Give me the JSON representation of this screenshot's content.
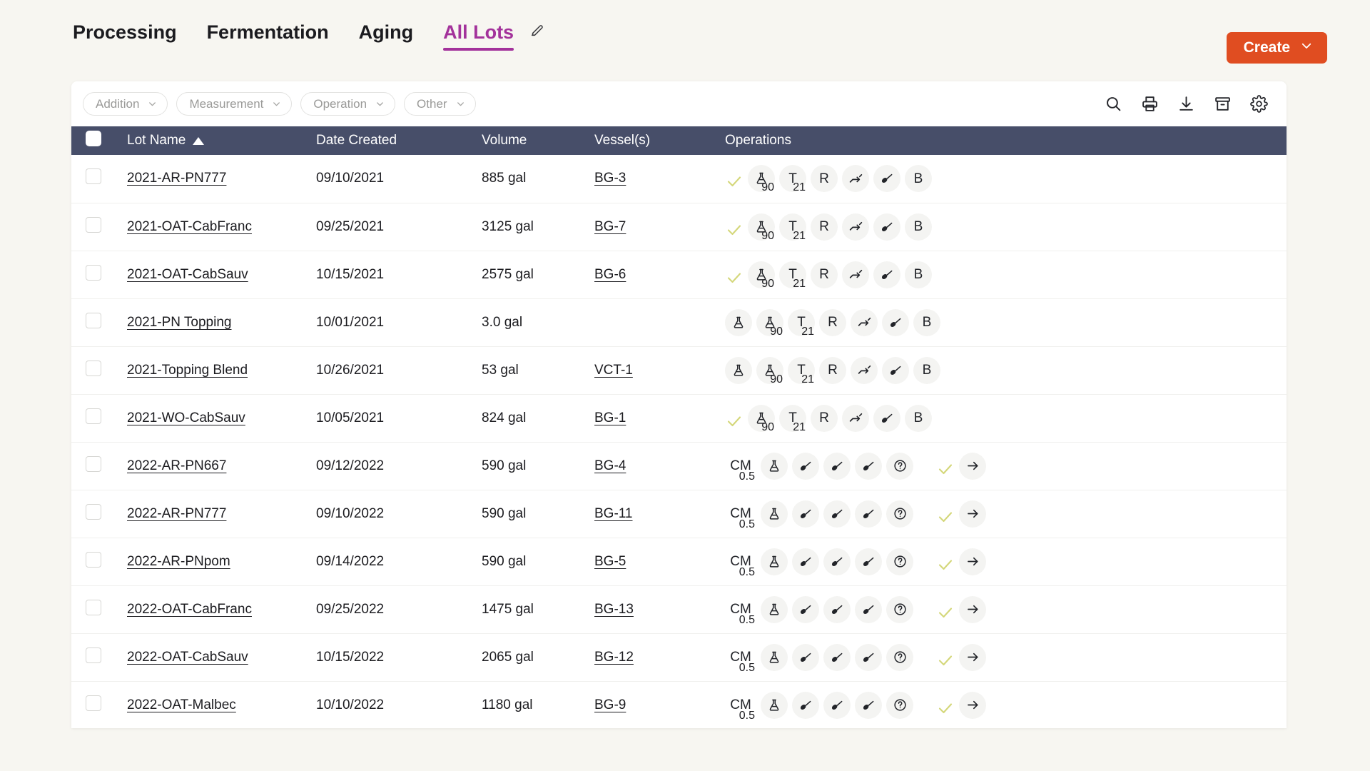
{
  "header": {
    "tabs": [
      {
        "label": "Processing",
        "active": false
      },
      {
        "label": "Fermentation",
        "active": false
      },
      {
        "label": "Aging",
        "active": false
      },
      {
        "label": "All Lots",
        "active": true
      }
    ],
    "edit_icon": "pencil-icon",
    "create_button": {
      "label": "Create",
      "icon": "chevron-down-icon",
      "color": "#e04d21"
    }
  },
  "toolbar": {
    "filters": [
      {
        "label": "Addition",
        "icon": "chevron-down-icon"
      },
      {
        "label": "Measurement",
        "icon": "chevron-down-icon"
      },
      {
        "label": "Operation",
        "icon": "chevron-down-icon"
      },
      {
        "label": "Other",
        "icon": "chevron-down-icon"
      }
    ],
    "actions": [
      {
        "name": "search-icon"
      },
      {
        "name": "print-icon"
      },
      {
        "name": "download-icon"
      },
      {
        "name": "archive-icon"
      },
      {
        "name": "gear-icon"
      }
    ]
  },
  "table": {
    "header_color": "#474e69",
    "select_all": false,
    "columns": [
      {
        "key": "lot_name",
        "label": "Lot Name",
        "sorted": "asc"
      },
      {
        "key": "date_created",
        "label": "Date Created"
      },
      {
        "key": "volume",
        "label": "Volume"
      },
      {
        "key": "vessels",
        "label": "Vessel(s)"
      },
      {
        "key": "operations",
        "label": "Operations"
      }
    ],
    "rows": [
      {
        "lot_name": "2021-AR-PN777",
        "date_created": "09/10/2021",
        "volume": "885 gal",
        "vessels": "BG-3",
        "ops": [
          {
            "type": "tick"
          },
          {
            "type": "badge",
            "icon": "flask-icon",
            "sub": "90"
          },
          {
            "type": "badge",
            "text": "T",
            "sub": "21"
          },
          {
            "type": "badge",
            "text": "R"
          },
          {
            "type": "badge",
            "icon": "pump-icon"
          },
          {
            "type": "badge",
            "icon": "ladle-icon"
          },
          {
            "type": "badge",
            "text": "B"
          }
        ]
      },
      {
        "lot_name": "2021-OAT-CabFranc",
        "date_created": "09/25/2021",
        "volume": "3125 gal",
        "vessels": "BG-7",
        "ops": [
          {
            "type": "tick"
          },
          {
            "type": "badge",
            "icon": "flask-icon",
            "sub": "90"
          },
          {
            "type": "badge",
            "text": "T",
            "sub": "21"
          },
          {
            "type": "badge",
            "text": "R"
          },
          {
            "type": "badge",
            "icon": "pump-icon"
          },
          {
            "type": "badge",
            "icon": "ladle-icon"
          },
          {
            "type": "badge",
            "text": "B"
          }
        ]
      },
      {
        "lot_name": "2021-OAT-CabSauv",
        "date_created": "10/15/2021",
        "volume": "2575 gal",
        "vessels": "BG-6",
        "ops": [
          {
            "type": "tick"
          },
          {
            "type": "badge",
            "icon": "flask-icon",
            "sub": "90"
          },
          {
            "type": "badge",
            "text": "T",
            "sub": "21"
          },
          {
            "type": "badge",
            "text": "R"
          },
          {
            "type": "badge",
            "icon": "pump-icon"
          },
          {
            "type": "badge",
            "icon": "ladle-icon"
          },
          {
            "type": "badge",
            "text": "B"
          }
        ]
      },
      {
        "lot_name": "2021-PN Topping",
        "date_created": "10/01/2021",
        "volume": "3.0 gal",
        "vessels": "",
        "ops": [
          {
            "type": "badge",
            "icon": "flask-icon"
          },
          {
            "type": "badge",
            "icon": "flask-icon",
            "sub": "90"
          },
          {
            "type": "badge",
            "text": "T",
            "sub": "21"
          },
          {
            "type": "badge",
            "text": "R"
          },
          {
            "type": "badge",
            "icon": "pump-icon"
          },
          {
            "type": "badge",
            "icon": "ladle-icon"
          },
          {
            "type": "badge",
            "text": "B"
          }
        ]
      },
      {
        "lot_name": "2021-Topping Blend",
        "date_created": "10/26/2021",
        "volume": "53 gal",
        "vessels": "VCT-1",
        "ops": [
          {
            "type": "badge",
            "icon": "flask-icon"
          },
          {
            "type": "badge",
            "icon": "flask-icon",
            "sub": "90"
          },
          {
            "type": "badge",
            "text": "T",
            "sub": "21"
          },
          {
            "type": "badge",
            "text": "R"
          },
          {
            "type": "badge",
            "icon": "pump-icon"
          },
          {
            "type": "badge",
            "icon": "ladle-icon"
          },
          {
            "type": "badge",
            "text": "B"
          }
        ]
      },
      {
        "lot_name": "2021-WO-CabSauv",
        "date_created": "10/05/2021",
        "volume": "824 gal",
        "vessels": "BG-1",
        "ops": [
          {
            "type": "tick"
          },
          {
            "type": "badge",
            "icon": "flask-icon",
            "sub": "90"
          },
          {
            "type": "badge",
            "text": "T",
            "sub": "21"
          },
          {
            "type": "badge",
            "text": "R"
          },
          {
            "type": "badge",
            "icon": "pump-icon"
          },
          {
            "type": "badge",
            "icon": "ladle-icon"
          },
          {
            "type": "badge",
            "text": "B"
          }
        ]
      },
      {
        "lot_name": "2022-AR-PN667",
        "date_created": "09/12/2022",
        "volume": "590 gal",
        "vessels": "BG-4",
        "ops": [
          {
            "type": "badge",
            "variant": "cm",
            "text": "CM",
            "sub": "0.5"
          },
          {
            "type": "badge",
            "icon": "flask-icon"
          },
          {
            "type": "badge",
            "icon": "ladle-icon"
          },
          {
            "type": "badge",
            "icon": "ladle-icon"
          },
          {
            "type": "badge",
            "icon": "ladle-icon"
          },
          {
            "type": "badge",
            "icon": "question-icon"
          },
          {
            "type": "gap"
          },
          {
            "type": "tick"
          },
          {
            "type": "badge",
            "icon": "arrow-right-icon"
          }
        ]
      },
      {
        "lot_name": "2022-AR-PN777",
        "date_created": "09/10/2022",
        "volume": "590 gal",
        "vessels": "BG-11",
        "ops": [
          {
            "type": "badge",
            "variant": "cm",
            "text": "CM",
            "sub": "0.5"
          },
          {
            "type": "badge",
            "icon": "flask-icon"
          },
          {
            "type": "badge",
            "icon": "ladle-icon"
          },
          {
            "type": "badge",
            "icon": "ladle-icon"
          },
          {
            "type": "badge",
            "icon": "ladle-icon"
          },
          {
            "type": "badge",
            "icon": "question-icon"
          },
          {
            "type": "gap"
          },
          {
            "type": "tick"
          },
          {
            "type": "badge",
            "icon": "arrow-right-icon"
          }
        ]
      },
      {
        "lot_name": "2022-AR-PNpom",
        "date_created": "09/14/2022",
        "volume": "590 gal",
        "vessels": "BG-5",
        "ops": [
          {
            "type": "badge",
            "variant": "cm",
            "text": "CM",
            "sub": "0.5"
          },
          {
            "type": "badge",
            "icon": "flask-icon"
          },
          {
            "type": "badge",
            "icon": "ladle-icon"
          },
          {
            "type": "badge",
            "icon": "ladle-icon"
          },
          {
            "type": "badge",
            "icon": "ladle-icon"
          },
          {
            "type": "badge",
            "icon": "question-icon"
          },
          {
            "type": "gap"
          },
          {
            "type": "tick"
          },
          {
            "type": "badge",
            "icon": "arrow-right-icon"
          }
        ]
      },
      {
        "lot_name": "2022-OAT-CabFranc",
        "date_created": "09/25/2022",
        "volume": "1475 gal",
        "vessels": "BG-13",
        "ops": [
          {
            "type": "badge",
            "variant": "cm",
            "text": "CM",
            "sub": "0.5"
          },
          {
            "type": "badge",
            "icon": "flask-icon"
          },
          {
            "type": "badge",
            "icon": "ladle-icon"
          },
          {
            "type": "badge",
            "icon": "ladle-icon"
          },
          {
            "type": "badge",
            "icon": "ladle-icon"
          },
          {
            "type": "badge",
            "icon": "question-icon"
          },
          {
            "type": "gap"
          },
          {
            "type": "tick"
          },
          {
            "type": "badge",
            "icon": "arrow-right-icon"
          }
        ]
      },
      {
        "lot_name": "2022-OAT-CabSauv",
        "date_created": "10/15/2022",
        "volume": "2065 gal",
        "vessels": "BG-12",
        "ops": [
          {
            "type": "badge",
            "variant": "cm",
            "text": "CM",
            "sub": "0.5"
          },
          {
            "type": "badge",
            "icon": "flask-icon"
          },
          {
            "type": "badge",
            "icon": "ladle-icon"
          },
          {
            "type": "badge",
            "icon": "ladle-icon"
          },
          {
            "type": "badge",
            "icon": "ladle-icon"
          },
          {
            "type": "badge",
            "icon": "question-icon"
          },
          {
            "type": "gap"
          },
          {
            "type": "tick"
          },
          {
            "type": "badge",
            "icon": "arrow-right-icon"
          }
        ]
      },
      {
        "lot_name": "2022-OAT-Malbec",
        "date_created": "10/10/2022",
        "volume": "1180 gal",
        "vessels": "BG-9",
        "ops": [
          {
            "type": "badge",
            "variant": "cm",
            "text": "CM",
            "sub": "0.5"
          },
          {
            "type": "badge",
            "icon": "flask-icon"
          },
          {
            "type": "badge",
            "icon": "ladle-icon"
          },
          {
            "type": "badge",
            "icon": "ladle-icon"
          },
          {
            "type": "badge",
            "icon": "ladle-icon"
          },
          {
            "type": "badge",
            "icon": "question-icon"
          },
          {
            "type": "gap"
          },
          {
            "type": "tick"
          },
          {
            "type": "badge",
            "icon": "arrow-right-icon"
          }
        ]
      }
    ]
  }
}
